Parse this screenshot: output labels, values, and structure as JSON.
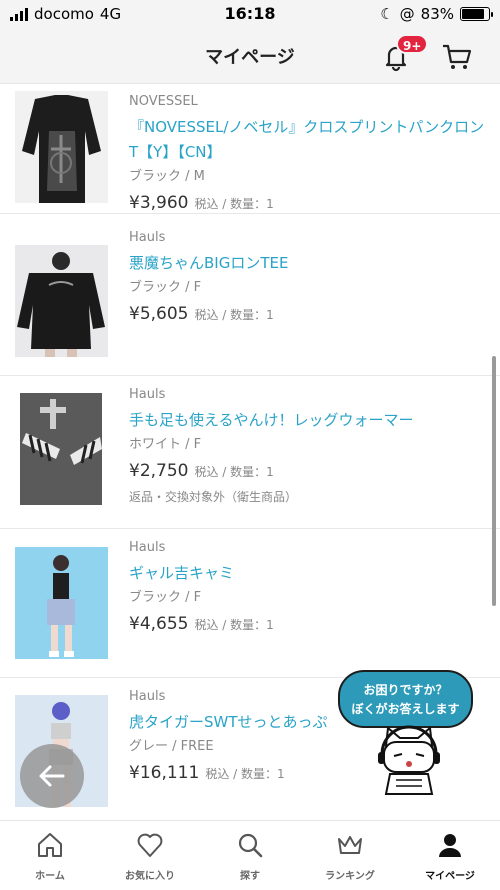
{
  "status_bar": {
    "carrier": "docomo",
    "network": "4G",
    "time": "16:18",
    "battery": "83%",
    "battery_level": 0.83
  },
  "header": {
    "title": "マイページ",
    "notification_badge": "9+"
  },
  "items": [
    {
      "brand": "NOVESSEL",
      "name": "『NOVESSEL/ノベセル』クロスプリントパンクロンT【Y】【CN】",
      "variant": "ブラック / M",
      "price": "¥3,960",
      "meta": "税込 / 数量：1",
      "note": ""
    },
    {
      "brand": "Hauls",
      "name": "悪魔ちゃんBIGロンTEE",
      "variant": "ブラック / F",
      "price": "¥5,605",
      "meta": "税込 / 数量：1",
      "note": ""
    },
    {
      "brand": "Hauls",
      "name": "手も足も使えるやんけ！レッグウォーマー",
      "variant": "ホワイト / F",
      "price": "¥2,750",
      "meta": "税込 / 数量：1",
      "note": "返品・交換対象外（衛生商品）"
    },
    {
      "brand": "Hauls",
      "name": "ギャル吉キャミ",
      "variant": "ブラック / F",
      "price": "¥4,655",
      "meta": "税込 / 数量：1",
      "note": ""
    },
    {
      "brand": "Hauls",
      "name": "虎タイガーSWTせっとあっぷ",
      "variant": "グレー / FREE",
      "price": "¥16,111",
      "meta": "税込 / 数量：1",
      "note": ""
    }
  ],
  "help": {
    "line1": "お困りですか？",
    "line2": "ぼくがお答えします"
  },
  "tabbar": [
    {
      "label": "ホーム",
      "icon": "home-icon"
    },
    {
      "label": "お気に入り",
      "icon": "heart-icon"
    },
    {
      "label": "探す",
      "icon": "search-icon"
    },
    {
      "label": "ランキング",
      "icon": "crown-icon"
    },
    {
      "label": "マイページ",
      "icon": "user-icon"
    }
  ],
  "colors": {
    "accent": "#2aa3c8",
    "badge": "#e2243e",
    "help_bubble": "#2c9ab8"
  }
}
